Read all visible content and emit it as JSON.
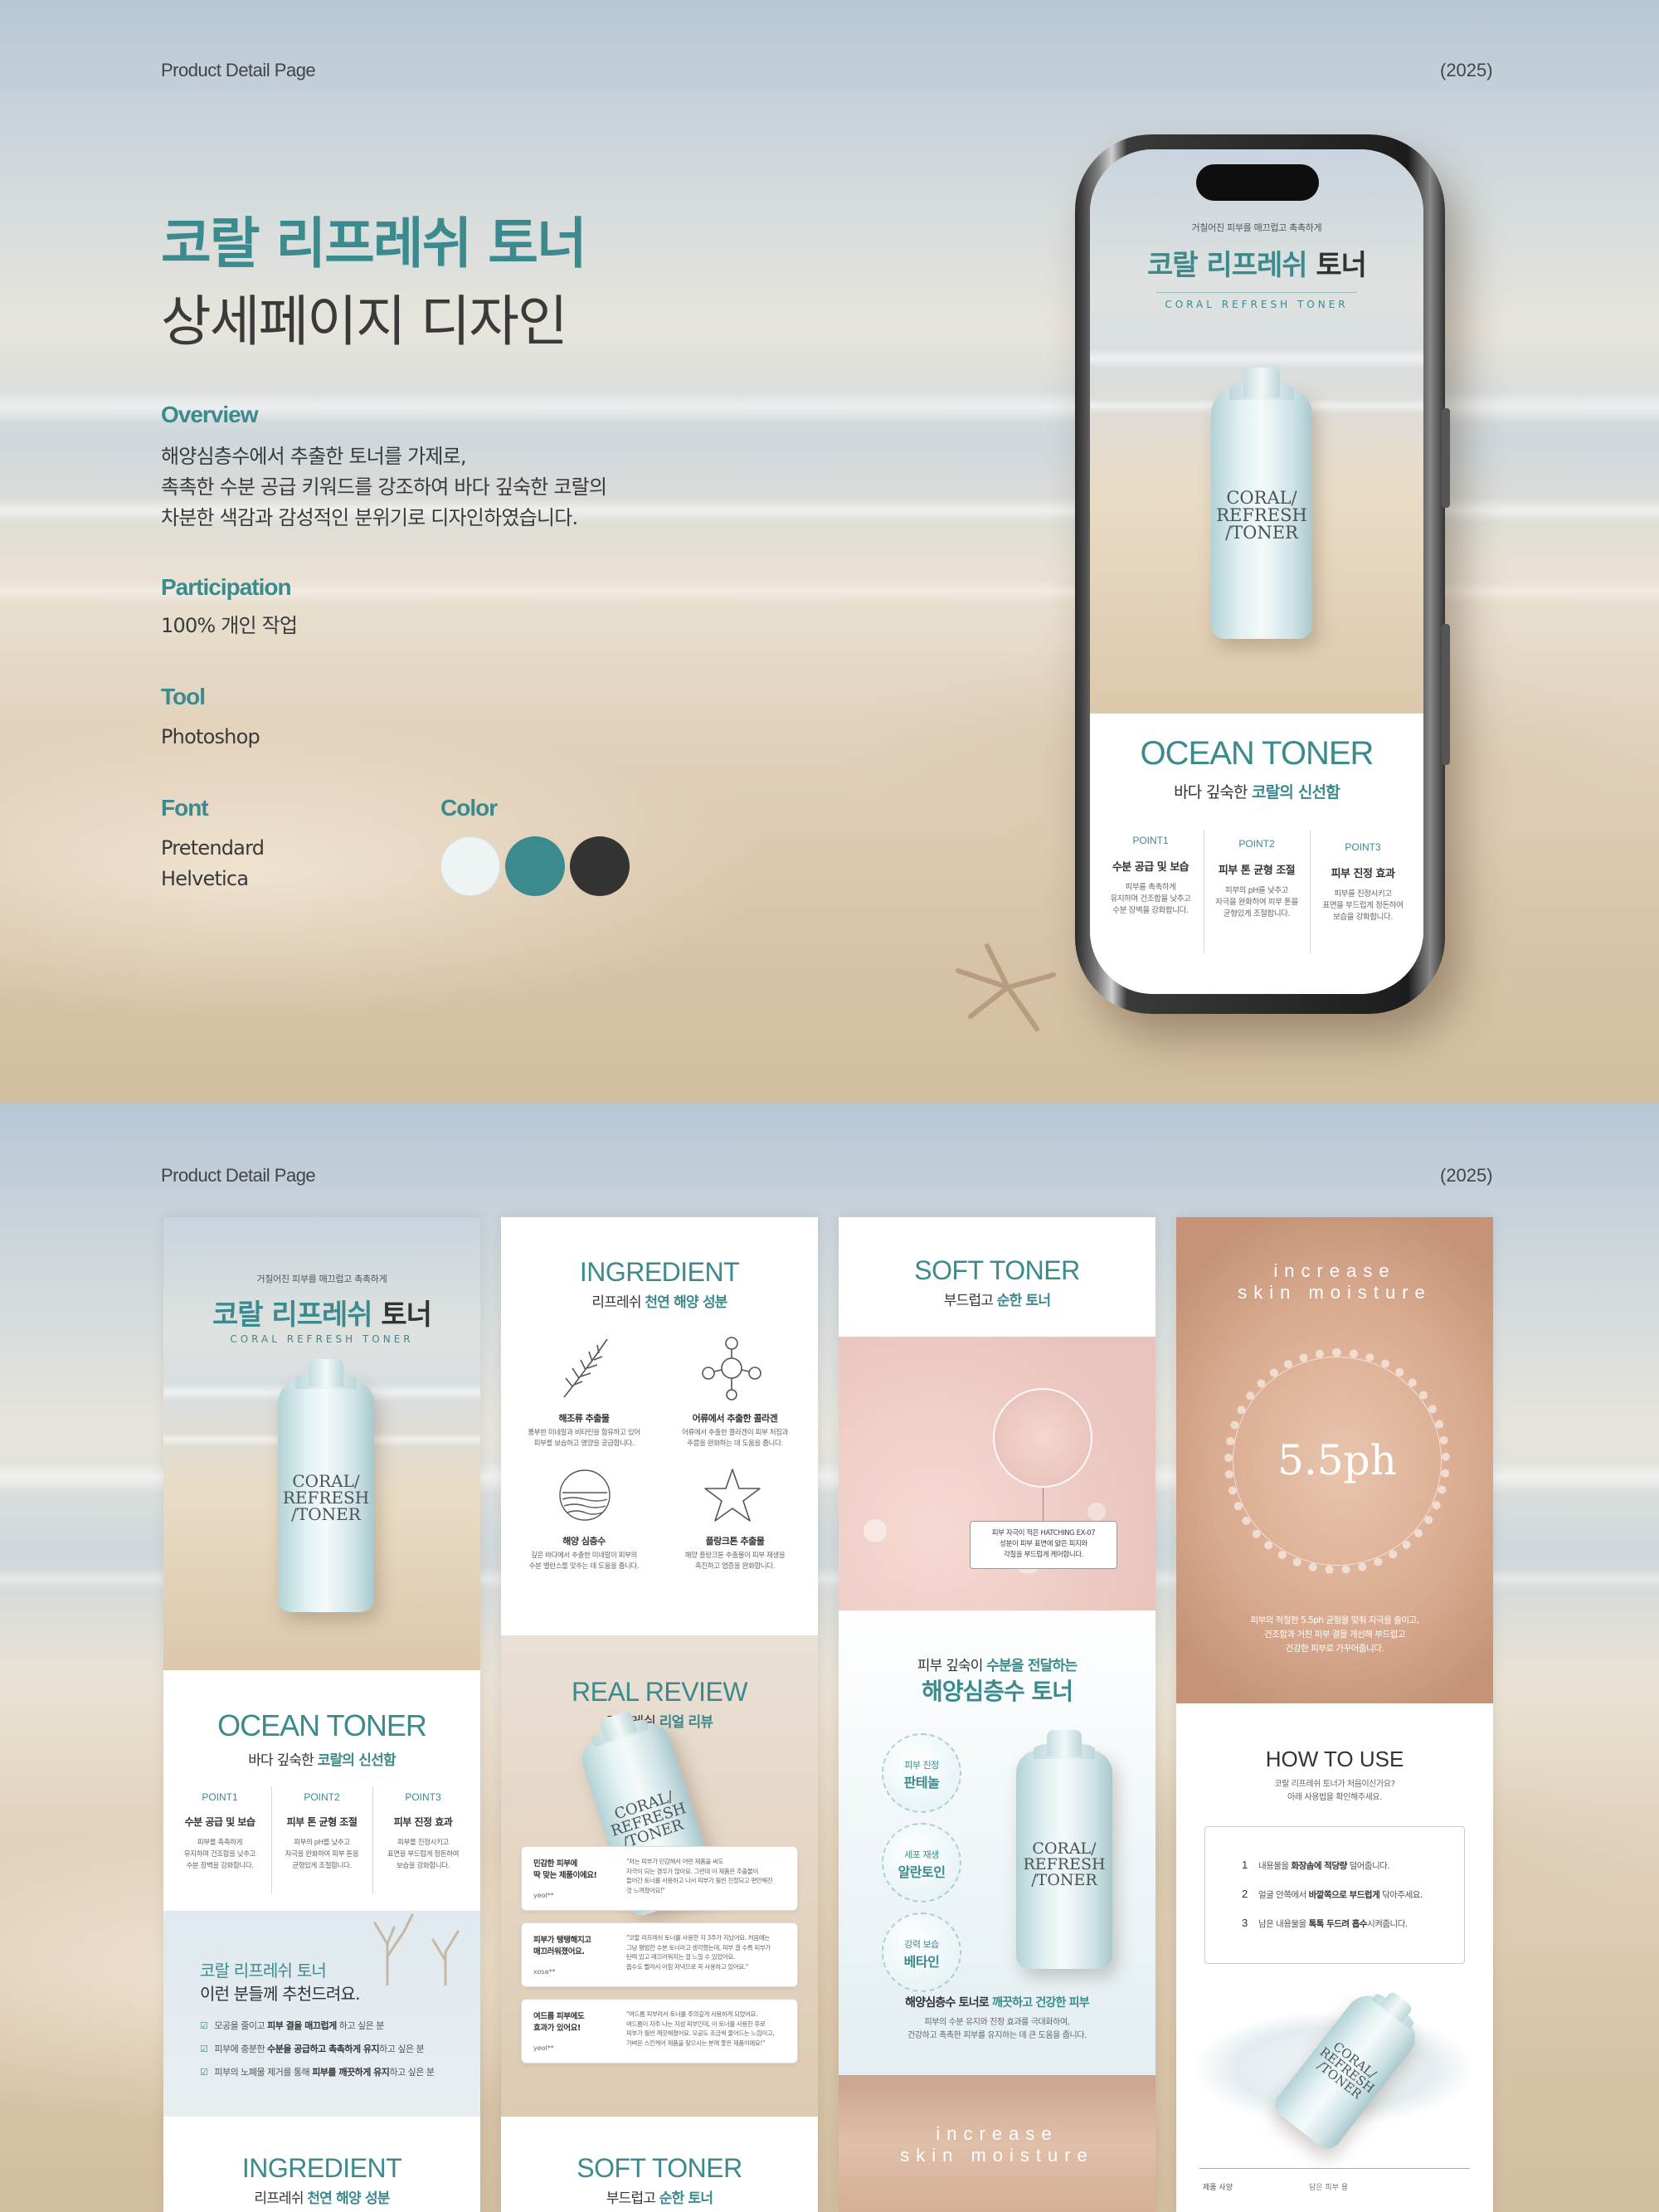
{
  "header": {
    "label": "Product Detail Page",
    "year": "(2025)"
  },
  "hero": {
    "title_line1": "코랄 리프레쉬 토너",
    "title_line2": "상세페이지 디자인",
    "overview": {
      "heading": "Overview",
      "lines": [
        "해양심층수에서 추출한 토너를 가제로,",
        "촉촉한 수분 공급 키워드를 강조하여 바다 깊숙한 코랄의",
        "차분한 색감과 감성적인 분위기로 디자인하였습니다."
      ]
    },
    "participation": {
      "heading": "Participation",
      "value": "100% 개인 작업"
    },
    "tool": {
      "heading": "Tool",
      "value": "Photoshop"
    },
    "font": {
      "heading": "Font",
      "values": [
        "Pretendard",
        "Helvetica"
      ]
    },
    "color": {
      "heading": "Color",
      "swatches": [
        "#eef3f4",
        "#3b8a8d",
        "#333333"
      ]
    }
  },
  "product": {
    "tagline": "거칠어진 피부를 매끄럽고 촉촉하게",
    "name_accent": "코랄 리프레쉬",
    "name_rest": "토너",
    "name_en": "CORAL REFRESH TONER",
    "bottle_label": [
      "CORAL/",
      "REFRESH",
      "/TONER"
    ],
    "ocean_title": "OCEAN TONER",
    "ocean_sub_plain": "바다 깊숙한",
    "ocean_sub_accent": "코랄의 신선함",
    "points": [
      {
        "label": "POINT1",
        "head": "수분 공급 및 보습",
        "desc": [
          "피부를 촉촉하게",
          "유지하며 건조함을 낮추고",
          "수분 장벽을 강화합니다."
        ]
      },
      {
        "label": "POINT2",
        "head": "피부 톤 균형 조절",
        "desc": [
          "피부의 pH를 낮추고",
          "자극을 완화하여 피부 톤을",
          "균형있게 조절합니다."
        ]
      },
      {
        "label": "POINT3",
        "head": "피부 진정 효과",
        "desc": [
          "피부를 진정시키고",
          "표면을 부드럽게 정돈하여",
          "보습을 강화합니다."
        ]
      }
    ]
  },
  "card1": {
    "rec_title_accent": "코랄 리프레쉬 토너",
    "rec_title_rest": "이런 분들께 추천드려요.",
    "rec_items": [
      {
        "pre": "모공을 줄이고 ",
        "bold": "피부 결을 매끄럽게",
        "post": " 하고 싶은 분"
      },
      {
        "pre": "피부에 충분한 ",
        "bold": "수분을 공급하고 촉촉하게 유지",
        "post": "하고 싶은 분"
      },
      {
        "pre": "피부의 노폐물 제거를 통해 ",
        "bold": "피부를 깨끗하게 유지",
        "post": "하고 싶은 분"
      }
    ],
    "next_title": "INGREDIENT",
    "next_sub_plain": "리프레쉬",
    "next_sub_accent": "천연 해양 성분"
  },
  "card2": {
    "title": "INGREDIENT",
    "sub_plain": "리프레쉬",
    "sub_accent": "천연 해양 성분",
    "ingredients": [
      {
        "icon": "seaweed-icon",
        "name": "해조류 추출물",
        "desc": [
          "풍부한 미네랄과 비타민을 함유하고 있어",
          "피부를 보습하고 영양을 공급합니다."
        ]
      },
      {
        "icon": "molecule-icon",
        "name": "어류에서 추출한 콜라겐",
        "desc": [
          "어류에서 추출한 콜라겐이 피부 처짐과",
          "주름을 완화하는 데 도움을 줍니다."
        ]
      },
      {
        "icon": "sea-icon",
        "name": "해양 심층수",
        "desc": [
          "깊은 바다에서 추출한 미네랄이 피부의",
          "수분 밸런스를 맞추는 데 도움을 줍니다."
        ]
      },
      {
        "icon": "starfish-icon",
        "name": "플랑크톤 추출물",
        "desc": [
          "해양 플랑크톤 추출물이 피부 재생을",
          "촉진하고 염증을 완화합니다."
        ]
      }
    ],
    "review_title": "REAL REVIEW",
    "review_sub_plain": "리프레쉬",
    "review_sub_accent": "리얼 리뷰",
    "reviews": [
      {
        "head": [
          "민감한 피부에",
          "딱 맞는 제품이에요!"
        ],
        "user": "yeol**",
        "body": [
          "\"저는 피부가 민감해서 어떤 제품을 써도",
          "자극이 되는 경우가 많아요. 그런데 이 제품은 추출물이",
          "들어간 토너를 사용하고 나서 피부가 훨씬 진정되고 편안해진",
          "것 느껴졌어요!\""
        ]
      },
      {
        "head": [
          "피부가 탱탱해지고",
          "매끄러워졌어요."
        ],
        "user": "xosa**",
        "body": [
          "\"코랄 리프레쉬 토너를 사용한 지 3주가 지났어요. 처음에는",
          "그냥 평범한 수분 토너라고 생각했는데, 피부 결 수록 피부가",
          "탄력 있고 매끄러워지는 걸 느낄 수 있었어요.",
          "흡수도 빨라서 아침 저녁으로 꼭 사용하고 있어요.\""
        ]
      },
      {
        "head": [
          "여드름 피부에도",
          "효과가 있어요!"
        ],
        "user": "yeol**",
        "body": [
          "\"여드름 피부라서 토너를 주의깊게 사용하게 되었어요.",
          "여드름이 자주 나는 지성 피부인데, 이 토너를 사용한 후로",
          "피부가 훨씬 깨끗해졌어요. 모공도 조금씩 줄어드는 느낌이고,",
          "가벼운 스킨케어 제품을 찾으시는 분께 좋은 제품이에요!\""
        ]
      }
    ],
    "next_title": "SOFT TONER",
    "next_sub_plain": "부드럽고",
    "next_sub_accent": "순한 토너"
  },
  "card3": {
    "title": "SOFT TONER",
    "sub_plain": "부드럽고",
    "sub_accent": "순한 토너",
    "callout": [
      "피부 자극이 적은 HATCHING EX-07",
      "성분이 피부 표면에 얇은 피지와",
      "각질을 부드럽게 케어합니다."
    ],
    "deep_line1_plain": "피부 깊숙이",
    "deep_line1_accent": "수분을 전달하는",
    "deep_title": "해양심층수 토너",
    "bubbles": [
      {
        "l1": "피부 진정",
        "l2": "판테놀"
      },
      {
        "l1": "세포 재생",
        "l2": "알란토인"
      },
      {
        "l1": "강력 보습",
        "l2": "베타인"
      }
    ],
    "bottom_line1_plain": "해양심층수 토너로",
    "bottom_line1_accent": "깨끗하고 건강한 피부",
    "bottom_line2": "피부의 수분 유지와 진정 효과를 극대화하여,",
    "bottom_line3": "건강하고 촉촉한 피부를 유지하는 데 큰 도움을 줍니다.",
    "moisture_text": [
      "increase",
      "skin moisture"
    ]
  },
  "card4": {
    "moisture_text": [
      "increase",
      "skin moisture"
    ],
    "ph": "5.5ph",
    "ph_desc": [
      "피부의 적절한 5.5ph 균형을 맞춰 자극을 줄이고,",
      "건조함과 거친 피부 결을 개선해 부드럽고",
      "건강한 피부로 가꾸어줍니다."
    ],
    "howto_title": "HOW TO USE",
    "howto_sub": [
      "코랄 리프레쉬 토너가 처음이신가요?",
      "아래 사용법을 확인해주세요."
    ],
    "steps": [
      {
        "num": "1",
        "pre": "내용물을 ",
        "bold": "화장솜에 적당량",
        "post": " 덜어줍니다."
      },
      {
        "num": "2",
        "pre": "얼굴 안쪽에서 ",
        "bold": "바깥쪽으로 부드럽게",
        "post": " 닦아주세요."
      },
      {
        "num": "3",
        "pre": "남은 내용물을 ",
        "bold": "톡톡 두드려 흡수",
        "post": "시켜줍니다."
      }
    ],
    "footer_left": "제품 사양",
    "footer_right": "담은 피부 용"
  },
  "colors": {
    "accent": "#3b8a8d",
    "text": "#333333"
  }
}
